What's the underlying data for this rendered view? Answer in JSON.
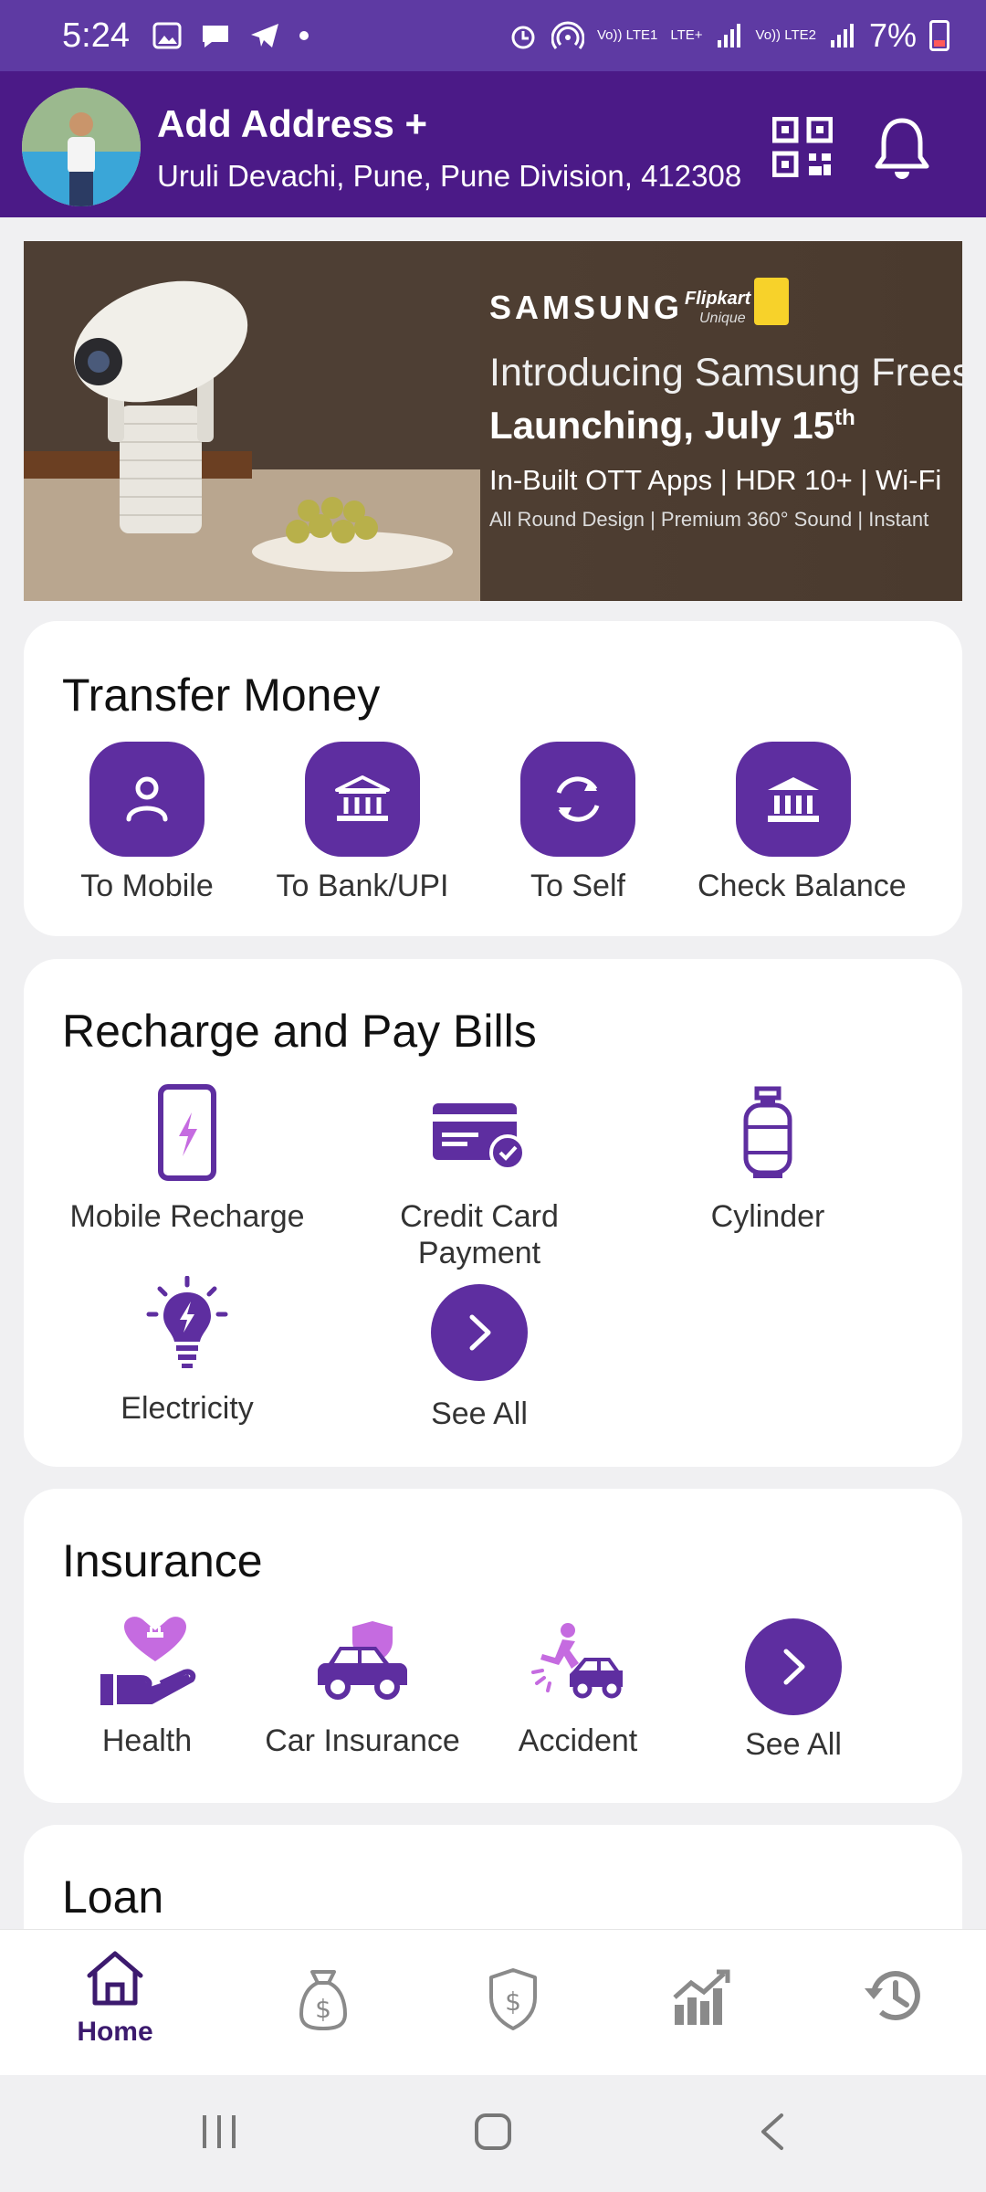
{
  "status_bar": {
    "time": "5:24",
    "battery": "7%",
    "sim1": "Vo)) LTE1",
    "sim2": "Vo)) LTE2",
    "network": "LTE+"
  },
  "header": {
    "title": "Add Address +",
    "address": "Uruli Devachi, Pune, Pune Division, 412308"
  },
  "banner": {
    "brand": "SAMSUNG",
    "partner": "Flipkart",
    "partner_tag": "Unique",
    "headline": "Introducing Samsung Freestyle",
    "launch": "Launching, July 15",
    "launch_sup": "th",
    "features": "In-Built OTT Apps | HDR 10+ | Wi-Fi",
    "details": "All Round Design | Premium 360° Sound | Instant"
  },
  "transfer_money": {
    "title": "Transfer Money",
    "items": [
      {
        "label": "To Mobile",
        "icon": "person-icon"
      },
      {
        "label": "To Bank/UPI",
        "icon": "bank-icon"
      },
      {
        "label": "To Self",
        "icon": "refresh-icon"
      },
      {
        "label": "Check Balance",
        "icon": "bank-icon"
      }
    ]
  },
  "recharge": {
    "title": "Recharge and Pay Bills",
    "items": [
      {
        "label": "Mobile Recharge",
        "icon": "mobile-recharge-icon"
      },
      {
        "label": "Credit Card Payment",
        "icon": "credit-card-icon"
      },
      {
        "label": "Cylinder",
        "icon": "cylinder-icon"
      },
      {
        "label": "Electricity",
        "icon": "bulb-icon"
      },
      {
        "label": "See All",
        "icon": "chevron-right-icon"
      }
    ]
  },
  "insurance": {
    "title": "Insurance",
    "items": [
      {
        "label": "Health",
        "icon": "health-icon"
      },
      {
        "label": "Car Insurance",
        "icon": "car-insurance-icon"
      },
      {
        "label": "Accident",
        "icon": "accident-icon"
      },
      {
        "label": "See All",
        "icon": "chevron-right-icon"
      }
    ]
  },
  "loan": {
    "title": "Loan"
  },
  "bottom_nav": {
    "items": [
      {
        "label": "Home",
        "icon": "home-icon",
        "active": true
      },
      {
        "label": "",
        "icon": "money-bag-icon"
      },
      {
        "label": "",
        "icon": "shield-dollar-icon"
      },
      {
        "label": "",
        "icon": "chart-icon"
      },
      {
        "label": "",
        "icon": "history-icon"
      }
    ]
  },
  "colors": {
    "primary": "#5e2ea0",
    "header_bg": "#4b1a87",
    "statusbar_bg": "#5e3aa3",
    "accent_light": "#c56be0"
  }
}
